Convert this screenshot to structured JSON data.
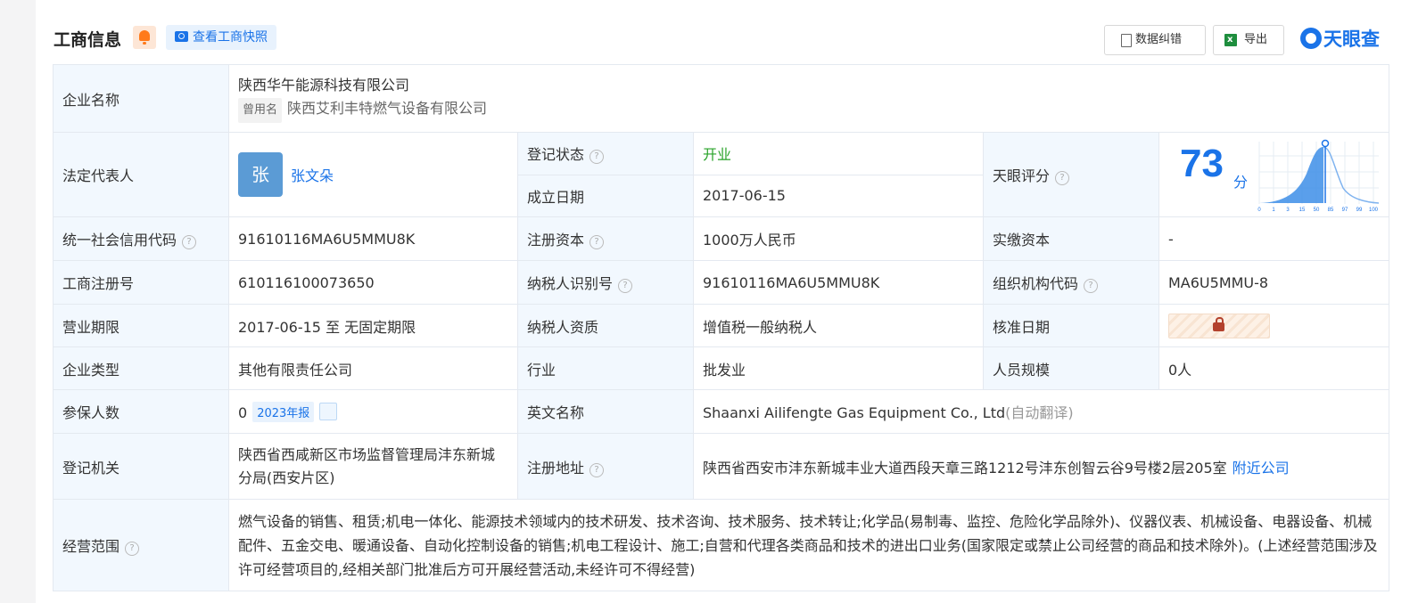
{
  "header": {
    "title": "工商信息",
    "snapshot_label": "查看工商快照",
    "correct_label": "数据纠错",
    "export_label": "导出",
    "brand": "天眼查"
  },
  "rows": {
    "company_name": {
      "label": "企业名称",
      "value": "陕西华午能源科技有限公司",
      "former_tag": "曾用名",
      "former_name": "陕西艾利丰特燃气设备有限公司"
    },
    "legal_rep": {
      "label": "法定代表人",
      "avatar_char": "张",
      "name": "张文朵"
    },
    "reg_status": {
      "label": "登记状态",
      "value": "开业"
    },
    "founded": {
      "label": "成立日期",
      "value": "2017-06-15"
    },
    "score": {
      "label": "天眼评分",
      "value": "73",
      "unit": "分",
      "ticks": [
        "0",
        "1",
        "3",
        "15",
        "50",
        "85",
        "97",
        "99",
        "100"
      ]
    },
    "credit_code": {
      "label": "统一社会信用代码",
      "value": "91610116MA6U5MMU8K"
    },
    "reg_capital": {
      "label": "注册资本",
      "value": "1000万人民币"
    },
    "paid_capital": {
      "label": "实缴资本",
      "value": "-"
    },
    "biz_reg_no": {
      "label": "工商注册号",
      "value": "610116100073650"
    },
    "taxpayer_id": {
      "label": "纳税人识别号",
      "value": "91610116MA6U5MMU8K"
    },
    "org_code": {
      "label": "组织机构代码",
      "value": "MA6U5MMU-8"
    },
    "term": {
      "label": "营业期限",
      "value": "2017-06-15 至 无固定期限"
    },
    "taxpayer_qual": {
      "label": "纳税人资质",
      "value": "增值税一般纳税人"
    },
    "approval_date": {
      "label": "核准日期"
    },
    "company_type": {
      "label": "企业类型",
      "value": "其他有限责任公司"
    },
    "industry": {
      "label": "行业",
      "value": "批发业"
    },
    "staff_size": {
      "label": "人员规模",
      "value": "0人"
    },
    "insured": {
      "label": "参保人数",
      "value": "0",
      "year_tag": "2023年报"
    },
    "english_name": {
      "label": "英文名称",
      "value": "Shaanxi Ailifengte Gas Equipment Co., Ltd",
      "note": "(自动翻译)"
    },
    "authority": {
      "label": "登记机关",
      "value": "陕西省西咸新区市场监督管理局沣东新城分局(西安片区)"
    },
    "address": {
      "label": "注册地址",
      "value": "陕西省西安市沣东新城丰业大道西段天章三路1212号沣东创智云谷9号楼2层205室",
      "nearby": "附近公司"
    },
    "scope": {
      "label": "经营范围",
      "value": "燃气设备的销售、租赁;机电一体化、能源技术领域内的技术研发、技术咨询、技术服务、技术转让;化学品(易制毒、监控、危险化学品除外)、仪器仪表、机械设备、电器设备、机械配件、五金交电、暖通设备、自动化控制设备的销售;机电工程设计、施工;自营和代理各类商品和技术的进出口业务(国家限定或禁止公司经营的商品和技术除外)。(上述经营范围涉及许可经营项目的,经相关部门批准后方可开展经营活动,未经许可不得经营)"
    }
  },
  "help_glyph": "?",
  "colors": {
    "accent": "#1a73e8",
    "label_bg": "#f2f8fe",
    "status_green": "#29a329"
  }
}
